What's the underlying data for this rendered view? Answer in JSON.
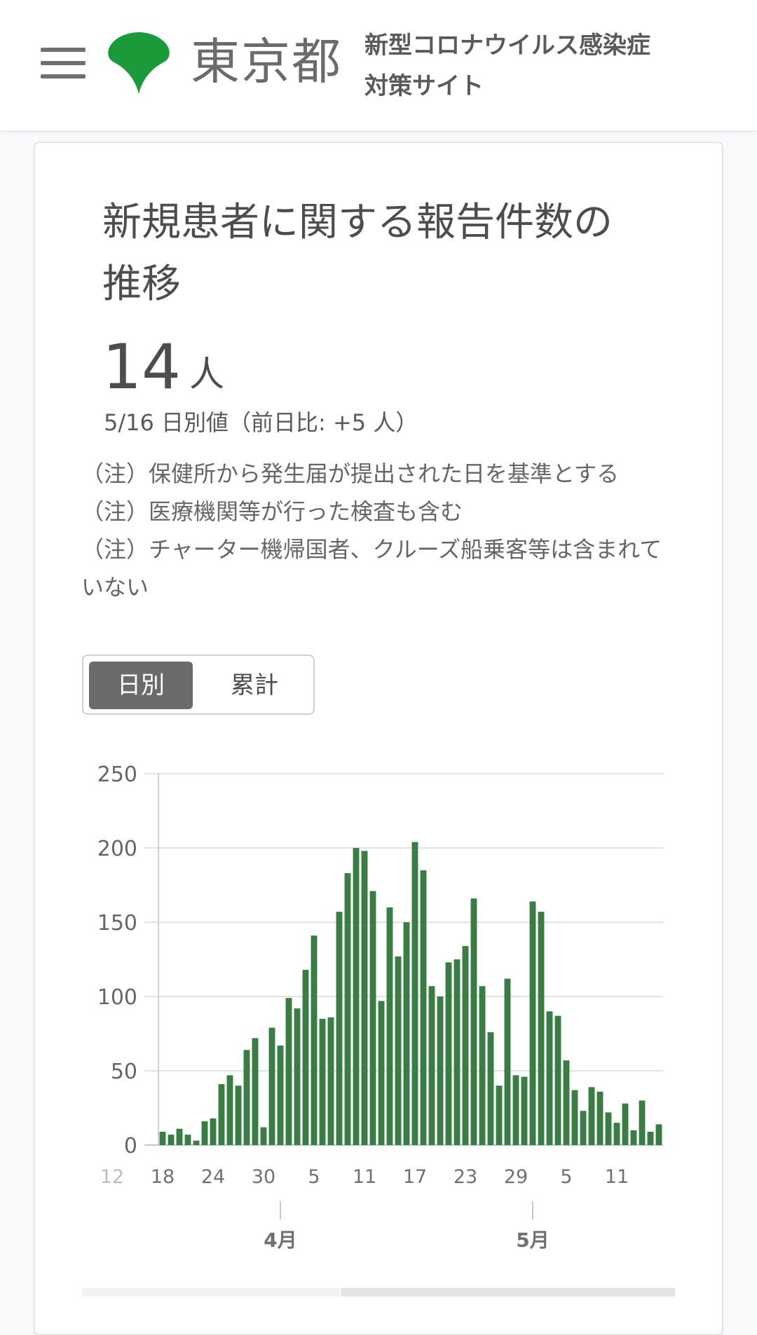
{
  "header": {
    "menu_icon": "hamburger-menu-icon",
    "logo_icon": "tokyo-ginkgo-logo-icon",
    "logo_color": "#1b9a3a",
    "logo_text": "東京都",
    "site_title_line1": "新型コロナウイルス感染症",
    "site_title_line2": "対策サイト"
  },
  "card": {
    "title": "新規患者に関する報告件数の推移",
    "value": "14",
    "unit": "人",
    "date_text": "5/16 日別値（前日比: +5 人）",
    "notes": [
      "（注）保健所から発生届が提出された日を基準とする",
      "（注）医療機関等が行った検査も含む",
      "（注）チャーター機帰国者、クルーズ船乗客等は含まれていない"
    ],
    "toggle": {
      "daily_label": "日別",
      "cumulative_label": "累計",
      "selected": "日別"
    }
  },
  "chart_data": {
    "type": "bar",
    "bar_color": "#3a7d44",
    "ylim": [
      0,
      250
    ],
    "yticks": [
      "0",
      "50",
      "100",
      "150",
      "200",
      "250"
    ],
    "x_tick_labels": [
      {
        "label": "12",
        "index": -6,
        "faded": true
      },
      {
        "label": "18",
        "index": 0
      },
      {
        "label": "24",
        "index": 6
      },
      {
        "label": "30",
        "index": 12
      },
      {
        "label": "5",
        "index": 18
      },
      {
        "label": "11",
        "index": 24
      },
      {
        "label": "17",
        "index": 30
      },
      {
        "label": "23",
        "index": 36
      },
      {
        "label": "29",
        "index": 42
      },
      {
        "label": "5",
        "index": 48
      },
      {
        "label": "11",
        "index": 54
      }
    ],
    "month_labels": [
      {
        "label": "4月",
        "index": 14
      },
      {
        "label": "5月",
        "index": 44
      }
    ],
    "x_start": "3/18",
    "x_end": "5/16",
    "values": [
      9,
      7,
      11,
      7,
      3,
      16,
      18,
      41,
      47,
      40,
      64,
      72,
      12,
      79,
      67,
      99,
      92,
      118,
      141,
      85,
      86,
      157,
      183,
      200,
      198,
      171,
      97,
      160,
      127,
      150,
      204,
      185,
      107,
      100,
      123,
      125,
      134,
      166,
      107,
      76,
      40,
      112,
      47,
      46,
      164,
      157,
      90,
      87,
      57,
      37,
      23,
      39,
      36,
      22,
      15,
      28,
      10,
      30,
      9,
      14
    ]
  }
}
